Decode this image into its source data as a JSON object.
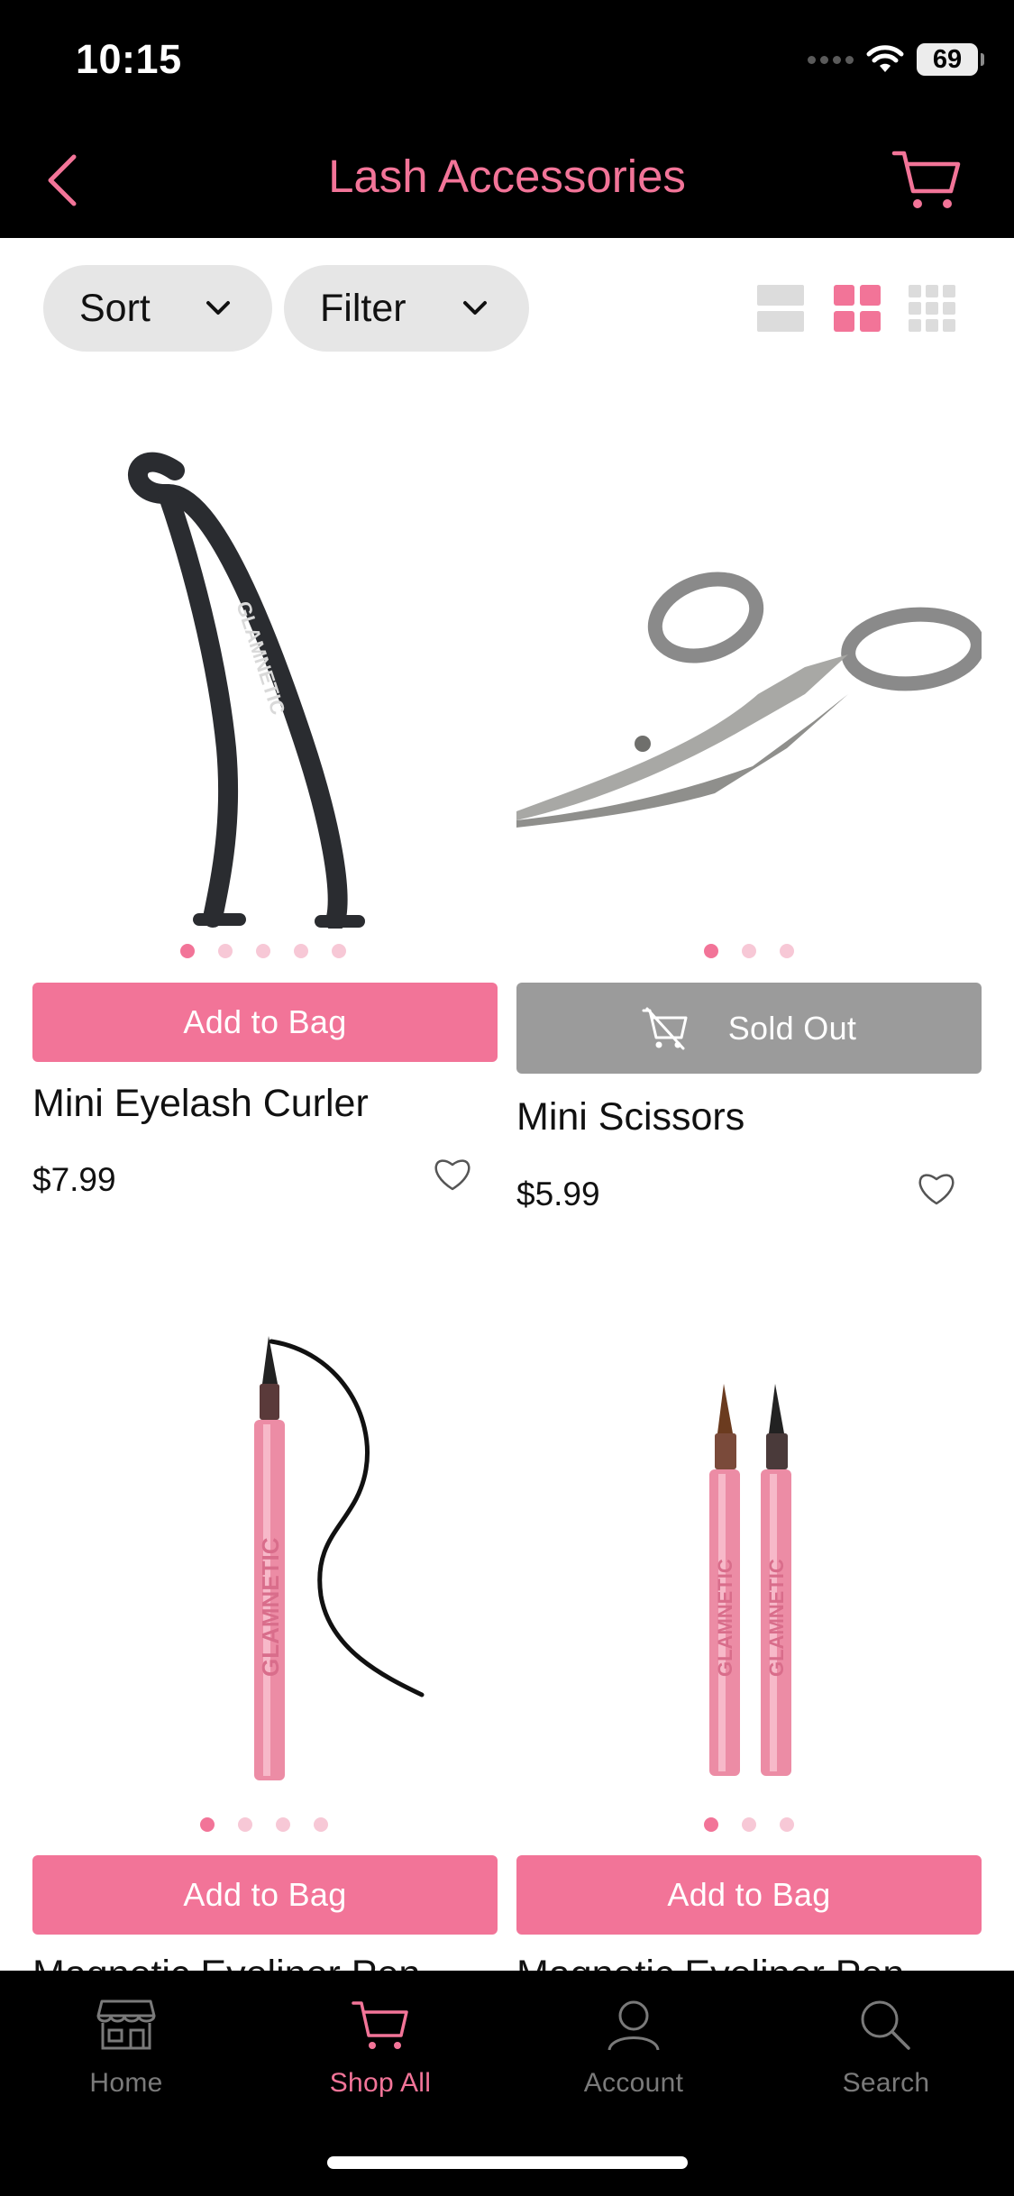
{
  "status_bar": {
    "time": "10:15",
    "battery": "69"
  },
  "header": {
    "title": "Lash Accessories"
  },
  "toolbar": {
    "sort_label": "Sort",
    "filter_label": "Filter"
  },
  "products": [
    {
      "name": "Mini Eyelash Curler",
      "price": "$7.99",
      "button": "Add to Bag",
      "image_count": 5,
      "active_image": 1
    },
    {
      "name": "Mini Scissors",
      "price": "$5.99",
      "button": "Sold Out",
      "image_count": 3,
      "active_image": 1
    },
    {
      "name": "Magnetic Eyeliner Pen",
      "button": "Add to Bag",
      "image_count": 4,
      "active_image": 1
    },
    {
      "name": "Magnetic Eyeliner Pen",
      "button": "Add to Bag",
      "image_count": 3,
      "active_image": 1
    }
  ],
  "tabbar": {
    "home": "Home",
    "shop_all": "Shop All",
    "account": "Account",
    "search": "Search"
  },
  "colors": {
    "accent": "#f27498",
    "header_bg": "#000000",
    "sold_out": "#9b9b9b",
    "pill_bg": "#e6e6e6"
  }
}
